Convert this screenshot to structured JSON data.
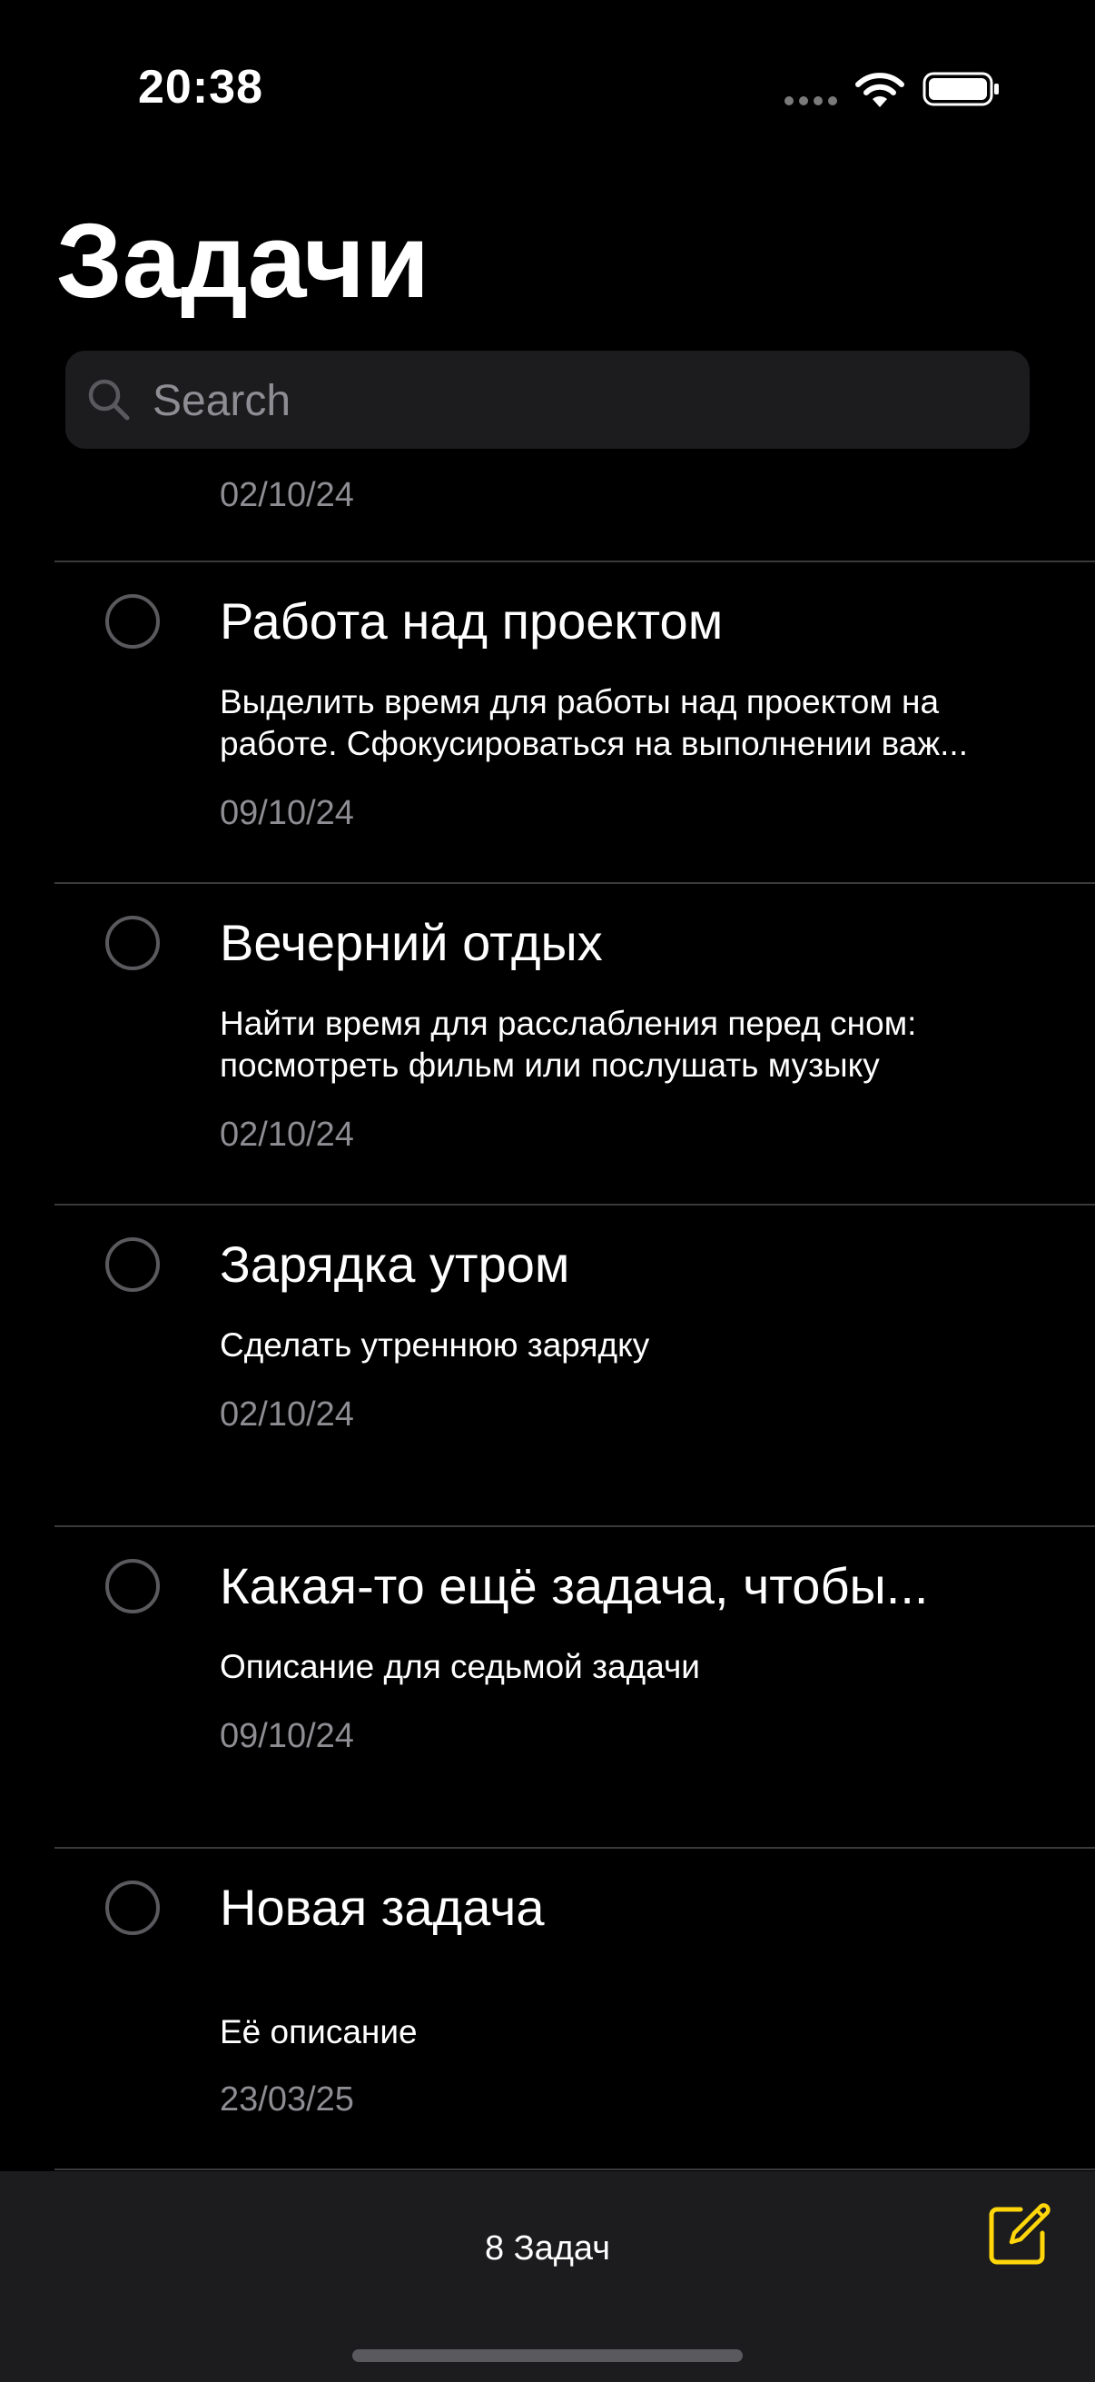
{
  "status_bar": {
    "time": "20:38"
  },
  "header": {
    "title": "Задачи"
  },
  "search": {
    "placeholder": "Search",
    "value": ""
  },
  "list": {
    "partial_top_date": "02/10/24",
    "tasks": [
      {
        "title": "Работа над проектом",
        "description": "Выделить время для работы над проектом на работе. Сфокусироваться на выполнении важ...",
        "date": "09/10/24",
        "completed": false
      },
      {
        "title": "Вечерний отдых",
        "description": "Найти время для расслабления перед сном: посмотреть фильм или послушать музыку",
        "date": "02/10/24",
        "completed": false
      },
      {
        "title": "Зарядка утром",
        "description": "Сделать утреннюю зарядку",
        "date": "02/10/24",
        "completed": false
      },
      {
        "title": "Какая-то ещё задача, чтобы...",
        "description": "Описание для седьмой задачи",
        "date": "09/10/24",
        "completed": false
      },
      {
        "title": "Новая задача",
        "description": "Её описание",
        "date": "23/03/25",
        "completed": false
      }
    ]
  },
  "footer": {
    "count_label": "8 Задач",
    "compose_icon": "square-and-pencil-icon"
  },
  "colors": {
    "background": "#000000",
    "bar": "#1c1c1e",
    "secondary_text": "#8d8d93",
    "accent": "#ffd60a",
    "divider": "#3a3a3c"
  }
}
